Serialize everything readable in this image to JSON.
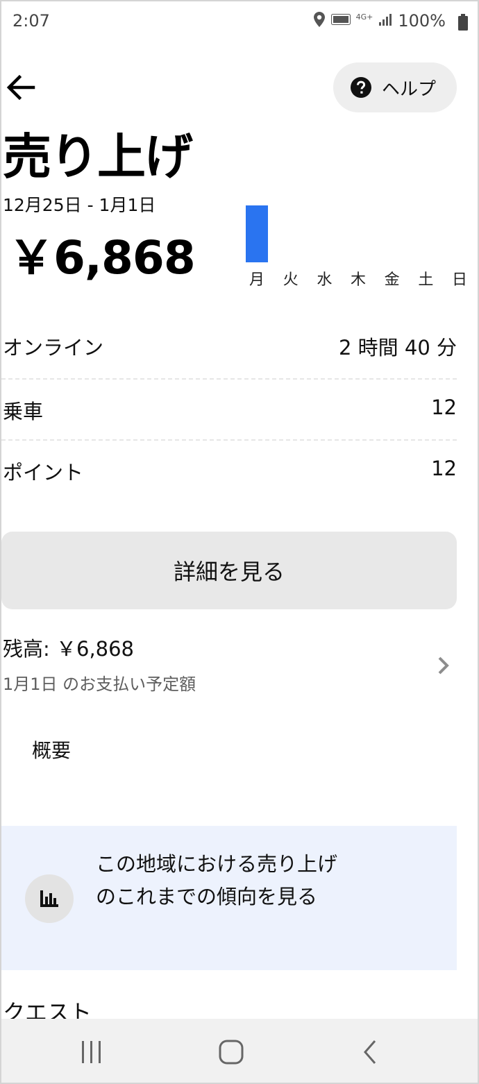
{
  "status_bar": {
    "time": "2:07",
    "battery": "100%",
    "network": "4G+"
  },
  "header": {
    "help_label": "ヘルプ",
    "title": "売り上げ"
  },
  "summary": {
    "date_range": "12月25日 - 1月1日",
    "total": "￥6,868"
  },
  "chart_data": {
    "type": "bar",
    "categories": [
      "月",
      "火",
      "水",
      "木",
      "金",
      "土",
      "日"
    ],
    "values": [
      6868,
      0,
      0,
      0,
      0,
      0,
      0
    ],
    "title": "",
    "xlabel": "",
    "ylabel": "",
    "bar_color": "#2a74f0",
    "grid": false
  },
  "stats": [
    {
      "label": "オンライン",
      "value": "2 時間 40 分"
    },
    {
      "label": "乗車",
      "value": "12"
    },
    {
      "label": "ポイント",
      "value": "12"
    }
  ],
  "details_button_label": "詳細を見る",
  "balance": {
    "label": "残高: ￥6,868",
    "sub": "1月1日 のお支払い予定額"
  },
  "overview_label": "概要",
  "trend_card": {
    "text": "この地域における売り上げのこれまでの傾向を見る"
  },
  "quest_label": "クエスト",
  "colors": {
    "accent": "#2a74f0",
    "card_bg": "#edf2fd",
    "button_bg": "#e8e8e8"
  },
  "icons": {
    "back": "arrow-left-icon",
    "help": "question-circle-icon",
    "trend": "bar-chart-icon",
    "chevron": "chevron-right-icon",
    "nav_recent": "recent-apps-icon",
    "nav_home": "home-icon",
    "nav_back": "back-icon"
  }
}
